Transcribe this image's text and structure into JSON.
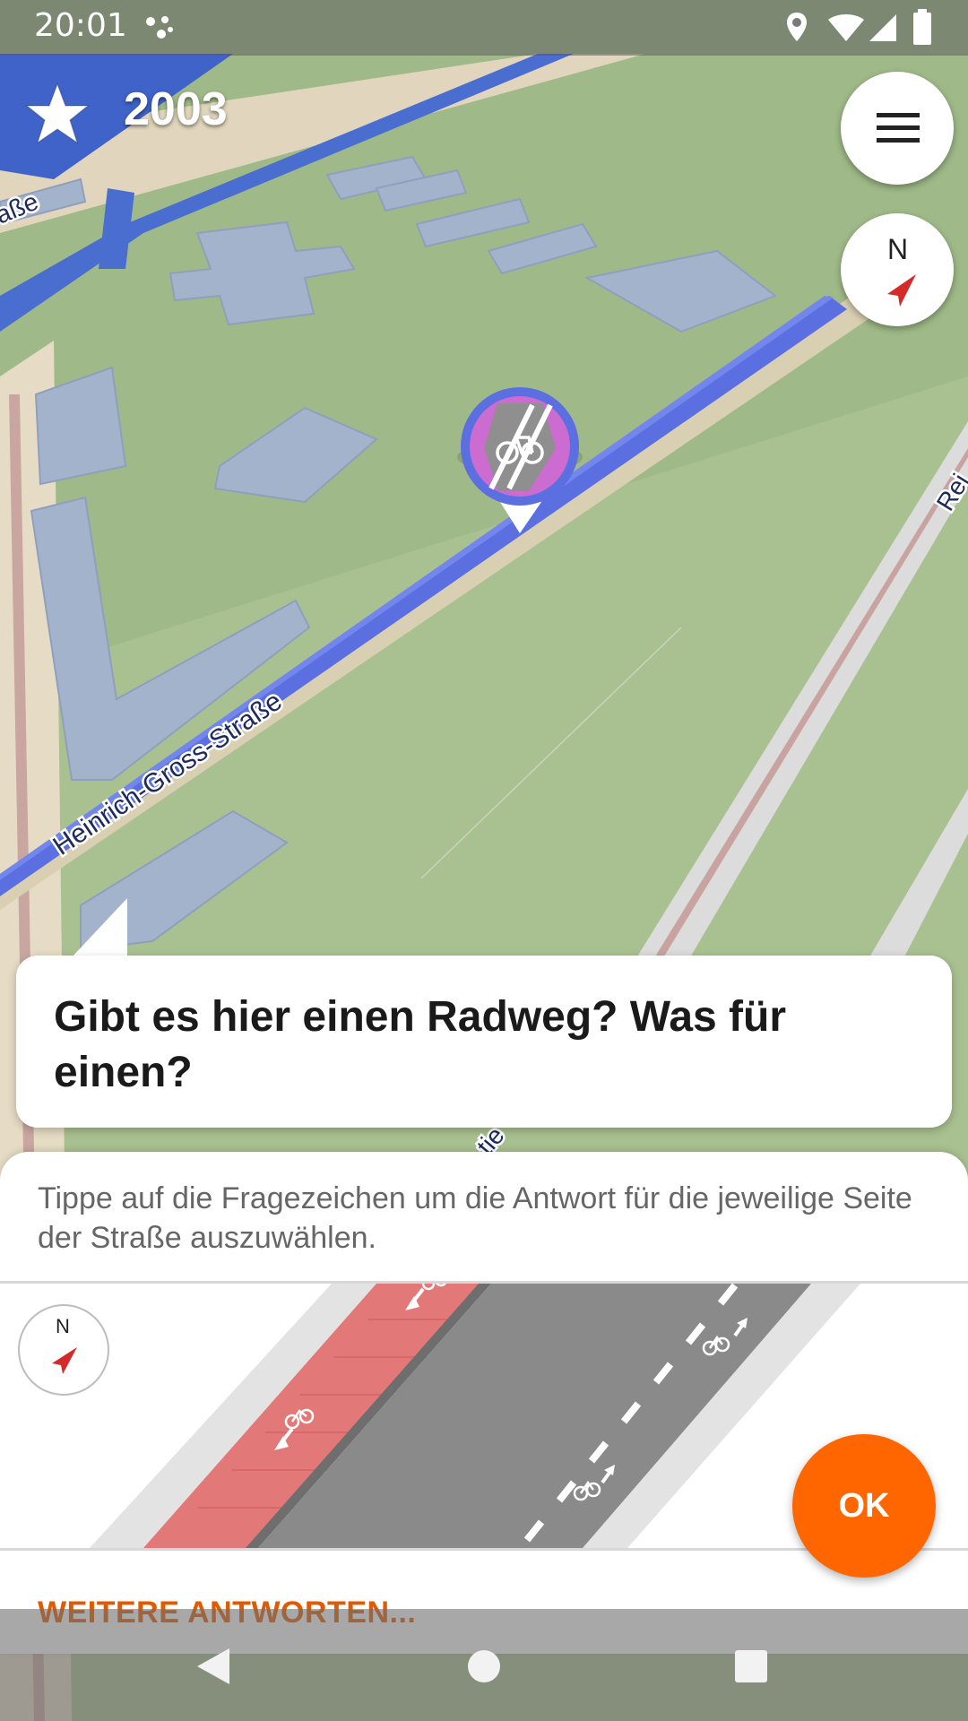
{
  "status_bar": {
    "time": "20:01",
    "icons": [
      "assistant-dots-icon",
      "location-icon",
      "wifi-icon",
      "signal-icon",
      "battery-icon"
    ]
  },
  "header": {
    "star_count": "2003"
  },
  "map": {
    "street_labels": [
      "Heinrich-Gross-Straße",
      "aße",
      "Rei",
      "tie"
    ],
    "compass_label": "N",
    "marker_icon": "bicycle-icon"
  },
  "quest": {
    "question": "Gibt es hier einen Radweg? Was für einen?",
    "hint": "Tippe auf die Fragezeichen um die Antwort für die jeweilige Seite der Straße auszuwählen.",
    "compass_label": "N",
    "ok_label": "OK",
    "more_answers_label": "WEITERE ANTWORTEN..."
  },
  "colors": {
    "accent": "#ff6600",
    "more_answers": "#e05a00",
    "route": "#5b6fe0",
    "bike_lane": "#e37878"
  }
}
